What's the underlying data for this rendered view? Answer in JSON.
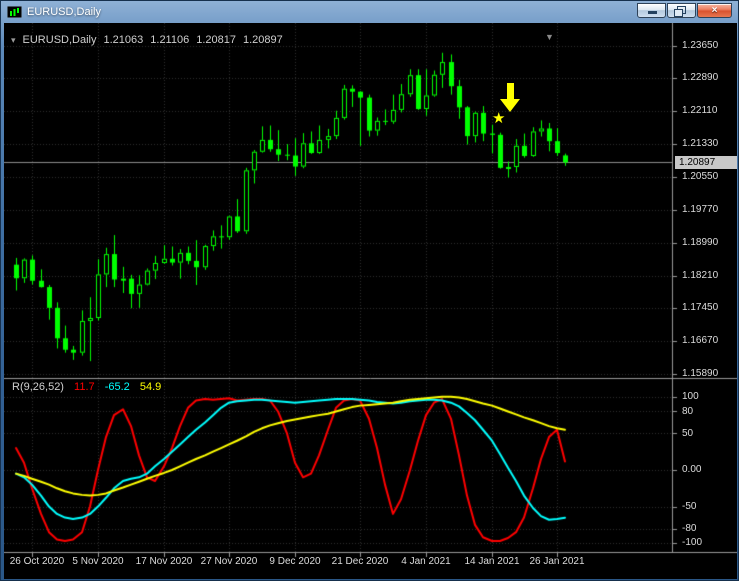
{
  "window": {
    "title": "EURUSD,Daily",
    "close_glyph": "×"
  },
  "icons": {
    "one_click_trading": "▾",
    "shift_marker": "▼",
    "star": "★",
    "arrow": "arrow-down"
  },
  "quote_line": {
    "symbol": "EURUSD,Daily",
    "open": "1.21063",
    "high": "1.21106",
    "low": "1.20817",
    "close": "1.20897"
  },
  "price_axis": {
    "labels": [
      "1.23650",
      "1.22890",
      "1.22110",
      "1.21330",
      "1.20550",
      "1.19770",
      "1.18990",
      "1.18210",
      "1.17450",
      "1.16670",
      "1.15890"
    ],
    "current_price": "1.20897"
  },
  "date_axis": {
    "labels": [
      "26 Oct 2020",
      "5 Nov 2020",
      "17 Nov 2020",
      "27 Nov 2020",
      "9 Dec 2020",
      "21 Dec 2020",
      "4 Jan 2021",
      "14 Jan 2021",
      "26 Jan 2021"
    ]
  },
  "indicator_panel": {
    "name": "R(9,26,52)",
    "values": [
      {
        "text": "11.7",
        "color": "#FF0000"
      },
      {
        "text": "-65.2",
        "color": "#00FFFF"
      },
      {
        "text": "54.9",
        "color": "#FFFF00"
      }
    ],
    "scale": [
      "100",
      "80",
      "50",
      "0.00",
      "-50",
      "-80",
      "-100"
    ]
  },
  "chart_data": {
    "type": "candlestick",
    "title": "EURUSD,Daily",
    "symbol": "EURUSD",
    "timeframe": "Daily",
    "current_price": 1.20897,
    "y_ticks": [
      1.2365,
      1.2289,
      1.2211,
      1.2133,
      1.2055,
      1.1977,
      1.1899,
      1.1821,
      1.1745,
      1.1667,
      1.1589
    ],
    "x_labels": [
      "26 Oct 2020",
      "5 Nov 2020",
      "17 Nov 2020",
      "27 Nov 2020",
      "9 Dec 2020",
      "21 Dec 2020",
      "4 Jan 2021",
      "14 Jan 2021",
      "26 Jan 2021"
    ],
    "x_label_indices": [
      2,
      10,
      18,
      26,
      34,
      42,
      50,
      58,
      66
    ],
    "colors": {
      "bull_fill": "#000000",
      "bear_fill": "#00FF00",
      "candle_outline": "#00FF00",
      "grid": "#303030",
      "price_line": "#8c8c8c",
      "separator": "#9a9a9a",
      "background": "#000000",
      "axis_text": "#dcdcdc",
      "object_color": "#FFFF00"
    },
    "candles": [
      [
        1.1848,
        1.1864,
        1.1787,
        1.1816
      ],
      [
        1.1816,
        1.1863,
        1.1805,
        1.186
      ],
      [
        1.186,
        1.187,
        1.1801,
        1.181
      ],
      [
        1.181,
        1.1837,
        1.1794,
        1.1795
      ],
      [
        1.1795,
        1.18,
        1.1718,
        1.1746
      ],
      [
        1.1746,
        1.1759,
        1.165,
        1.1674
      ],
      [
        1.1674,
        1.1704,
        1.164,
        1.1647
      ],
      [
        1.1647,
        1.1656,
        1.1623,
        1.164
      ],
      [
        1.164,
        1.174,
        1.1633,
        1.1715
      ],
      [
        1.1715,
        1.1771,
        1.162,
        1.1722
      ],
      [
        1.1722,
        1.1861,
        1.1716,
        1.1825
      ],
      [
        1.1825,
        1.1888,
        1.1795,
        1.1873
      ],
      [
        1.1873,
        1.1918,
        1.1795,
        1.1813
      ],
      [
        1.1813,
        1.1843,
        1.1781,
        1.1815
      ],
      [
        1.1815,
        1.1824,
        1.1745,
        1.1779
      ],
      [
        1.1779,
        1.1823,
        1.1746,
        1.1801
      ],
      [
        1.1801,
        1.1839,
        1.1799,
        1.1834
      ],
      [
        1.1834,
        1.1869,
        1.1814,
        1.1852
      ],
      [
        1.1852,
        1.1894,
        1.185,
        1.1862
      ],
      [
        1.1862,
        1.1891,
        1.1846,
        1.1853
      ],
      [
        1.1853,
        1.1885,
        1.1815,
        1.1876
      ],
      [
        1.1876,
        1.1891,
        1.1849,
        1.1857
      ],
      [
        1.1857,
        1.1906,
        1.18,
        1.1842
      ],
      [
        1.1842,
        1.1895,
        1.1836,
        1.1892
      ],
      [
        1.1892,
        1.1929,
        1.1881,
        1.1915
      ],
      [
        1.1915,
        1.1941,
        1.1886,
        1.1913
      ],
      [
        1.1913,
        1.1964,
        1.1907,
        1.1962
      ],
      [
        1.1962,
        1.2003,
        1.1923,
        1.1927
      ],
      [
        1.1927,
        1.2077,
        1.1921,
        1.2071
      ],
      [
        1.2071,
        1.2119,
        1.204,
        1.2115
      ],
      [
        1.2115,
        1.2175,
        1.2113,
        1.2143
      ],
      [
        1.2143,
        1.2177,
        1.2115,
        1.2121
      ],
      [
        1.2121,
        1.2166,
        1.2093,
        1.2108
      ],
      [
        1.2108,
        1.2133,
        1.2095,
        1.2106
      ],
      [
        1.2106,
        1.2147,
        1.2058,
        1.208
      ],
      [
        1.208,
        1.2159,
        1.2076,
        1.2135
      ],
      [
        1.2135,
        1.2163,
        1.211,
        1.2112
      ],
      [
        1.2112,
        1.2177,
        1.211,
        1.2143
      ],
      [
        1.2143,
        1.2169,
        1.2123,
        1.2152
      ],
      [
        1.2152,
        1.2212,
        1.2145,
        1.2195
      ],
      [
        1.2195,
        1.2273,
        1.2191,
        1.2264
      ],
      [
        1.2264,
        1.2272,
        1.2221,
        1.2257
      ],
      [
        1.2257,
        1.2258,
        1.2129,
        1.2243
      ],
      [
        1.2243,
        1.225,
        1.2151,
        1.2165
      ],
      [
        1.2165,
        1.2196,
        1.2153,
        1.2188
      ],
      [
        1.2188,
        1.2215,
        1.2178,
        1.2186
      ],
      [
        1.2186,
        1.225,
        1.2181,
        1.2214
      ],
      [
        1.2214,
        1.2275,
        1.2208,
        1.2251
      ],
      [
        1.2251,
        1.231,
        1.2245,
        1.2296
      ],
      [
        1.2296,
        1.231,
        1.2214,
        1.2216
      ],
      [
        1.2216,
        1.231,
        1.22,
        1.2248
      ],
      [
        1.2248,
        1.2307,
        1.2245,
        1.2297
      ],
      [
        1.2297,
        1.2349,
        1.2266,
        1.2327
      ],
      [
        1.2327,
        1.2345,
        1.225,
        1.227
      ],
      [
        1.227,
        1.2285,
        1.2193,
        1.222
      ],
      [
        1.222,
        1.2223,
        1.2132,
        1.2152
      ],
      [
        1.2152,
        1.221,
        1.2137,
        1.2207
      ],
      [
        1.2207,
        1.2223,
        1.214,
        1.2158
      ],
      [
        1.2158,
        1.2179,
        1.2111,
        1.2155
      ],
      [
        1.2155,
        1.216,
        1.2075,
        1.2077
      ],
      [
        1.2077,
        1.2092,
        1.2054,
        1.2079
      ],
      [
        1.2079,
        1.2145,
        1.2066,
        1.2129
      ],
      [
        1.2129,
        1.2158,
        1.2101,
        1.2105
      ],
      [
        1.2105,
        1.2173,
        1.2103,
        1.2163
      ],
      [
        1.2163,
        1.2189,
        1.2151,
        1.217
      ],
      [
        1.217,
        1.2183,
        1.2116,
        1.214
      ],
      [
        1.214,
        1.2171,
        1.2105,
        1.2112
      ],
      [
        1.21063,
        1.21106,
        1.20817,
        1.20897
      ]
    ],
    "oscillator": {
      "name": "R(9,26,52)",
      "range": [
        -100,
        100
      ],
      "levels": [
        100,
        80,
        50,
        0,
        -50,
        -80,
        -100
      ],
      "series": [
        {
          "name": "line1",
          "color": "#FF0000",
          "current": 11.7,
          "values": [
            30,
            10,
            -25,
            -60,
            -85,
            -95,
            -97,
            -95,
            -85,
            -50,
            0,
            45,
            75,
            83,
            60,
            20,
            -10,
            -15,
            5,
            30,
            60,
            85,
            95,
            97,
            96,
            97,
            98,
            95,
            96,
            97,
            97,
            95,
            80,
            50,
            10,
            -10,
            -5,
            20,
            55,
            85,
            95,
            97,
            95,
            70,
            30,
            -20,
            -60,
            -40,
            0,
            40,
            75,
            92,
            97,
            70,
            20,
            -35,
            -75,
            -92,
            -97,
            -97,
            -93,
            -85,
            -65,
            -25,
            15,
            45,
            55,
            11.7
          ]
        },
        {
          "name": "line2",
          "color": "#00FFFF",
          "current": -65.2,
          "values": [
            -5,
            -10,
            -20,
            -35,
            -50,
            -60,
            -65,
            -67,
            -65,
            -60,
            -50,
            -38,
            -25,
            -15,
            -12,
            -10,
            -5,
            5,
            15,
            25,
            35,
            45,
            55,
            65,
            75,
            85,
            92,
            94,
            95,
            96,
            96,
            95,
            94,
            93,
            92,
            93,
            94,
            95,
            96,
            97,
            97,
            97,
            96,
            95,
            93,
            92,
            91,
            92,
            94,
            95,
            96,
            96,
            95,
            92,
            87,
            78,
            68,
            55,
            40,
            22,
            3,
            -15,
            -35,
            -52,
            -63,
            -68,
            -67,
            -65.2
          ]
        },
        {
          "name": "line3",
          "color": "#FFFF00",
          "current": 54.9,
          "values": [
            -5,
            -8,
            -12,
            -16,
            -20,
            -25,
            -29,
            -32,
            -34,
            -35,
            -34,
            -32,
            -28,
            -24,
            -20,
            -16,
            -12,
            -8,
            -4,
            0,
            5,
            10,
            15,
            20,
            25,
            30,
            35,
            40,
            46,
            52,
            57,
            61,
            64,
            67,
            69,
            71,
            73,
            75,
            77,
            80,
            83,
            86,
            88,
            89,
            90,
            91,
            92,
            94,
            96,
            97,
            98,
            99,
            100,
            100,
            99,
            97,
            94,
            91,
            88,
            84,
            80,
            76,
            72,
            68,
            64,
            60,
            57,
            54.9
          ]
        }
      ]
    }
  }
}
